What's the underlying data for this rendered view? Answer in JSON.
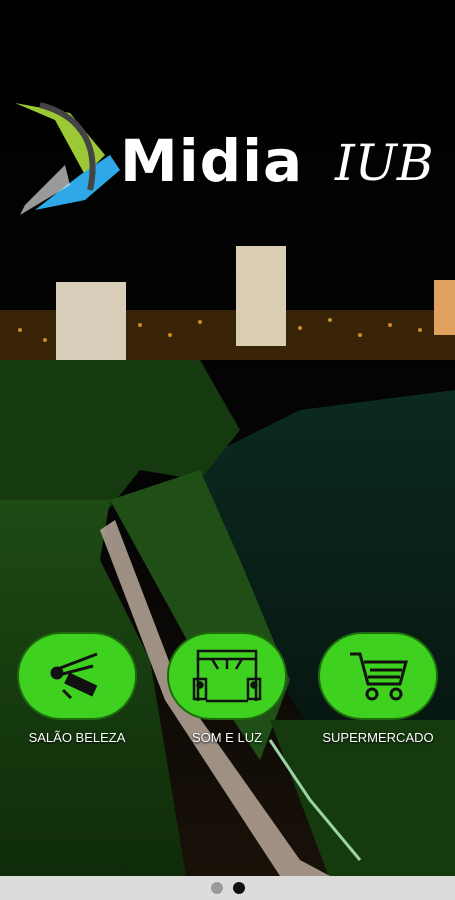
{
  "logo": {
    "main": "Midia",
    "script": "IUB"
  },
  "categories": [
    {
      "label": "SALÃO BELEZA",
      "icon": "hair-tools-icon"
    },
    {
      "label": "SOM E LUZ",
      "icon": "stage-lights-icon"
    },
    {
      "label": "SUPERMERCADO",
      "icon": "shopping-cart-icon"
    }
  ],
  "pager": {
    "pages": 2,
    "current": 2
  },
  "colors": {
    "button_green": "#3fd11f",
    "button_border": "#1e6b0d"
  }
}
